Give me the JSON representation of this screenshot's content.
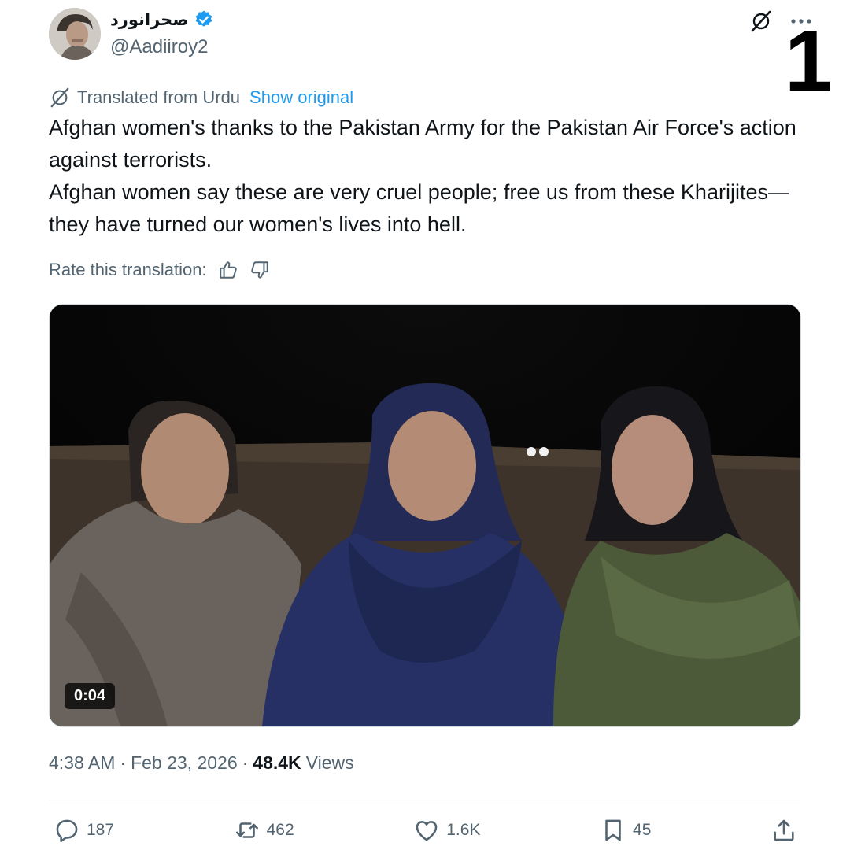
{
  "author": {
    "display_name": "صحرانورد",
    "handle": "@Aadiiroy2"
  },
  "corner_number": "1",
  "translation": {
    "label": "Translated from Urdu",
    "show_original": "Show original"
  },
  "tweet": {
    "paragraph1": "Afghan women's thanks to the Pakistan Army for the Pakistan Air Force's action against terrorists.",
    "paragraph2": "Afghan women say these are very cruel people; free us from these Kharijites—they have turned our women's lives into hell."
  },
  "rate_label": "Rate this translation:",
  "media": {
    "duration": "0:04"
  },
  "meta": {
    "time": "4:38 AM",
    "sep1": "·",
    "date": "Feb 23, 2026",
    "sep2": "·",
    "views_count": "48.4K",
    "views_label": "Views"
  },
  "actions": {
    "replies": "187",
    "reposts": "462",
    "likes": "1.6K",
    "bookmarks": "45"
  },
  "colors": {
    "accent": "#1d9bf0",
    "muted": "#536471",
    "text": "#0f1419"
  }
}
